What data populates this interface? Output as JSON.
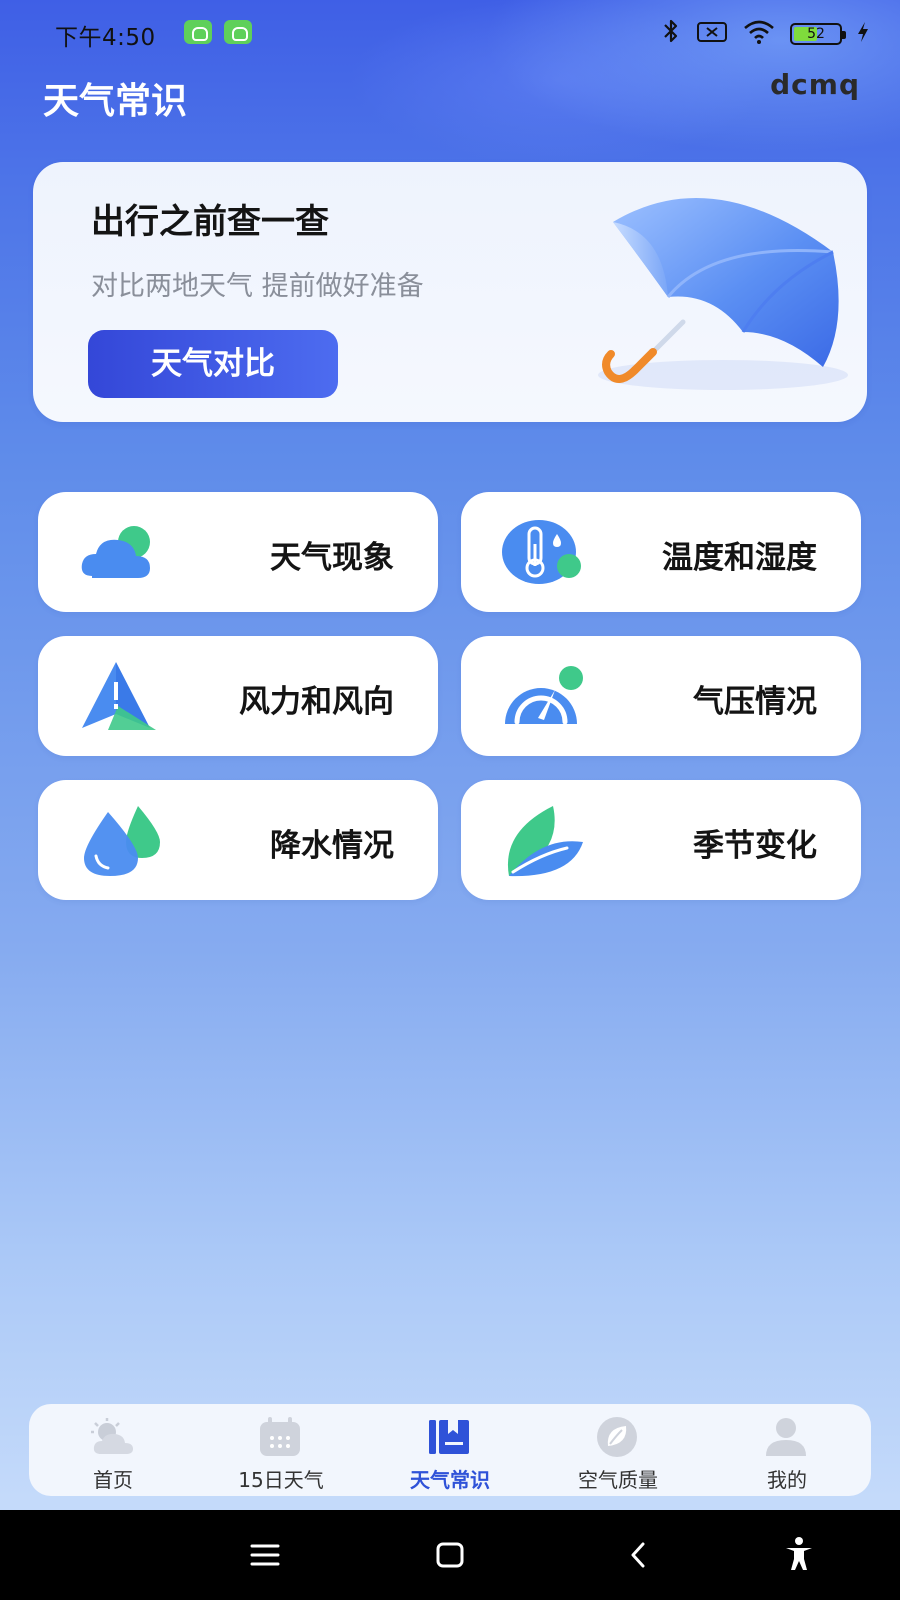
{
  "status_bar": {
    "time": "下午4:50",
    "battery_level": "52",
    "battery_fraction": 0.52
  },
  "header": {
    "title": "天气常识",
    "brand": "dcmq"
  },
  "banner": {
    "title": "出行之前查一查",
    "subtitle": "对比两地天气 提前做好准备",
    "button_label": "天气对比"
  },
  "topics": [
    {
      "label": "天气现象",
      "icon": "cloud-icon"
    },
    {
      "label": "温度和湿度",
      "icon": "thermometer-icon"
    },
    {
      "label": "风力和风向",
      "icon": "wind-direction-icon"
    },
    {
      "label": "气压情况",
      "icon": "pressure-gauge-icon"
    },
    {
      "label": "降水情况",
      "icon": "raindrop-icon"
    },
    {
      "label": "季节变化",
      "icon": "leaf-icon"
    }
  ],
  "bottom_nav": {
    "items": [
      {
        "label": "首页",
        "icon": "weather-icon",
        "active": false
      },
      {
        "label": "15日天气",
        "icon": "calendar-icon",
        "active": false
      },
      {
        "label": "天气常识",
        "icon": "book-icon",
        "active": true
      },
      {
        "label": "空气质量",
        "icon": "leaf-circle-icon",
        "active": false
      },
      {
        "label": "我的",
        "icon": "profile-icon",
        "active": false
      }
    ]
  },
  "colors": {
    "accent": "#3447d8",
    "active_tab": "#2f52d8",
    "icon_blue": "#4a8cf0",
    "icon_green": "#3fc98a"
  }
}
